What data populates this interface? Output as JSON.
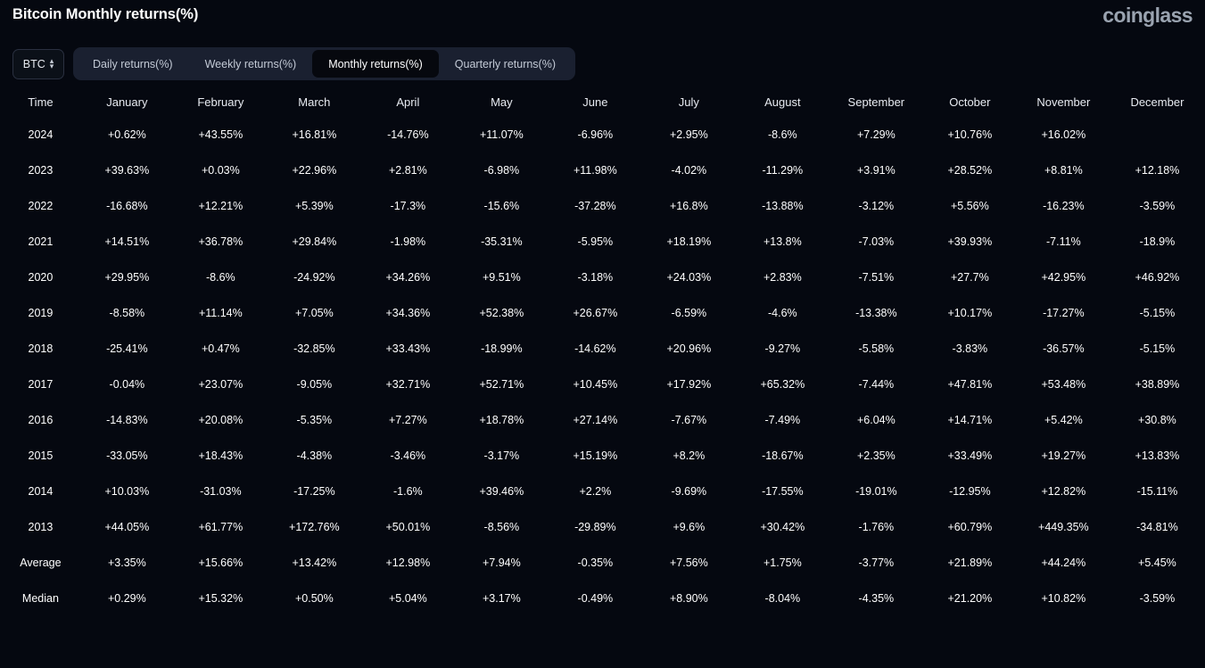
{
  "header": {
    "title": "Bitcoin Monthly returns(%)",
    "brand": "coinglass"
  },
  "controls": {
    "asset": "BTC",
    "asset_icon": "chevron-up-down-icon",
    "tabs": [
      {
        "label": "Daily returns(%)",
        "active": false
      },
      {
        "label": "Weekly returns(%)",
        "active": false
      },
      {
        "label": "Monthly returns(%)",
        "active": true
      },
      {
        "label": "Quarterly returns(%)",
        "active": false
      }
    ]
  },
  "colors": {
    "positive": "#4ecb8e",
    "negative": "#fa7b7e",
    "neutral": "#666666",
    "background": "#050810",
    "tab_bar": "#1a2030",
    "tab_active": "#06080e"
  },
  "chart_data": {
    "type": "heatmap",
    "title": "Bitcoin Monthly returns(%)",
    "xlabel": "",
    "ylabel": "Time",
    "categories": [
      "January",
      "February",
      "March",
      "April",
      "May",
      "June",
      "July",
      "August",
      "September",
      "October",
      "November",
      "December"
    ],
    "row_header": "Time",
    "rows": [
      {
        "label": "2024",
        "kind": "year",
        "values": [
          "+0.62%",
          "+43.55%",
          "+16.81%",
          "-14.76%",
          "+11.07%",
          "-6.96%",
          "+2.95%",
          "-8.6%",
          "+7.29%",
          "+10.76%",
          "+16.02%",
          ""
        ]
      },
      {
        "label": "2023",
        "kind": "year",
        "values": [
          "+39.63%",
          "+0.03%",
          "+22.96%",
          "+2.81%",
          "-6.98%",
          "+11.98%",
          "-4.02%",
          "-11.29%",
          "+3.91%",
          "+28.52%",
          "+8.81%",
          "+12.18%"
        ]
      },
      {
        "label": "2022",
        "kind": "year",
        "values": [
          "-16.68%",
          "+12.21%",
          "+5.39%",
          "-17.3%",
          "-15.6%",
          "-37.28%",
          "+16.8%",
          "-13.88%",
          "-3.12%",
          "+5.56%",
          "-16.23%",
          "-3.59%"
        ]
      },
      {
        "label": "2021",
        "kind": "year",
        "values": [
          "+14.51%",
          "+36.78%",
          "+29.84%",
          "-1.98%",
          "-35.31%",
          "-5.95%",
          "+18.19%",
          "+13.8%",
          "-7.03%",
          "+39.93%",
          "-7.11%",
          "-18.9%"
        ]
      },
      {
        "label": "2020",
        "kind": "year",
        "values": [
          "+29.95%",
          "-8.6%",
          "-24.92%",
          "+34.26%",
          "+9.51%",
          "-3.18%",
          "+24.03%",
          "+2.83%",
          "-7.51%",
          "+27.7%",
          "+42.95%",
          "+46.92%"
        ]
      },
      {
        "label": "2019",
        "kind": "year",
        "values": [
          "-8.58%",
          "+11.14%",
          "+7.05%",
          "+34.36%",
          "+52.38%",
          "+26.67%",
          "-6.59%",
          "-4.6%",
          "-13.38%",
          "+10.17%",
          "-17.27%",
          "-5.15%"
        ]
      },
      {
        "label": "2018",
        "kind": "year",
        "values": [
          "-25.41%",
          "+0.47%",
          "-32.85%",
          "+33.43%",
          "-18.99%",
          "-14.62%",
          "+20.96%",
          "-9.27%",
          "-5.58%",
          "-3.83%",
          "-36.57%",
          "-5.15%"
        ]
      },
      {
        "label": "2017",
        "kind": "year",
        "values": [
          "-0.04%",
          "+23.07%",
          "-9.05%",
          "+32.71%",
          "+52.71%",
          "+10.45%",
          "+17.92%",
          "+65.32%",
          "-7.44%",
          "+47.81%",
          "+53.48%",
          "+38.89%"
        ]
      },
      {
        "label": "2016",
        "kind": "year",
        "values": [
          "-14.83%",
          "+20.08%",
          "-5.35%",
          "+7.27%",
          "+18.78%",
          "+27.14%",
          "-7.67%",
          "-7.49%",
          "+6.04%",
          "+14.71%",
          "+5.42%",
          "+30.8%"
        ]
      },
      {
        "label": "2015",
        "kind": "year",
        "values": [
          "-33.05%",
          "+18.43%",
          "-4.38%",
          "-3.46%",
          "-3.17%",
          "+15.19%",
          "+8.2%",
          "-18.67%",
          "+2.35%",
          "+33.49%",
          "+19.27%",
          "+13.83%"
        ]
      },
      {
        "label": "2014",
        "kind": "year",
        "values": [
          "+10.03%",
          "-31.03%",
          "-17.25%",
          "-1.6%",
          "+39.46%",
          "+2.2%",
          "-9.69%",
          "-17.55%",
          "-19.01%",
          "-12.95%",
          "+12.82%",
          "-15.11%"
        ]
      },
      {
        "label": "2013",
        "kind": "year",
        "values": [
          "+44.05%",
          "+61.77%",
          "+172.76%",
          "+50.01%",
          "-8.56%",
          "-29.89%",
          "+9.6%",
          "+30.42%",
          "-1.76%",
          "+60.79%",
          "+449.35%",
          "-34.81%"
        ]
      },
      {
        "label": "Average",
        "kind": "summary",
        "values": [
          "+3.35%",
          "+15.66%",
          "+13.42%",
          "+12.98%",
          "+7.94%",
          "-0.35%",
          "+7.56%",
          "+1.75%",
          "-3.77%",
          "+21.89%",
          "+44.24%",
          "+5.45%"
        ]
      },
      {
        "label": "Median",
        "kind": "summary",
        "values": [
          "+0.29%",
          "+15.32%",
          "+0.50%",
          "+5.04%",
          "+3.17%",
          "-0.49%",
          "+8.90%",
          "-8.04%",
          "-4.35%",
          "+21.20%",
          "+10.82%",
          "-3.59%"
        ]
      }
    ]
  }
}
